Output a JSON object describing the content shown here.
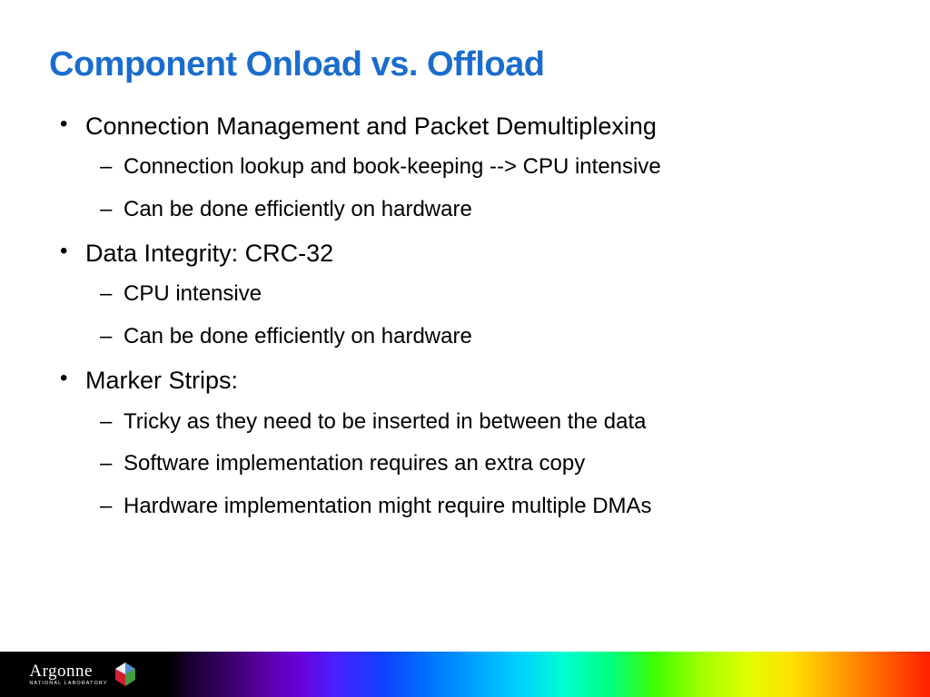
{
  "title": "Component Onload vs. Offload",
  "bullets": {
    "b0": "Connection Management and Packet Demultiplexing",
    "b0_0": "Connection lookup and book-keeping --> CPU intensive",
    "b0_1": "Can be done efficiently on hardware",
    "b1": "Data Integrity: CRC-32",
    "b1_0": "CPU intensive",
    "b1_1": "Can be done efficiently on hardware",
    "b2": "Marker Strips:",
    "b2_0": "Tricky as they need to be inserted in between the data",
    "b2_1": "Software implementation requires an extra copy",
    "b2_2": "Hardware implementation might require multiple DMAs"
  },
  "footer": {
    "org_main": "Argonne",
    "org_sub": "NATIONAL LABORATORY"
  }
}
